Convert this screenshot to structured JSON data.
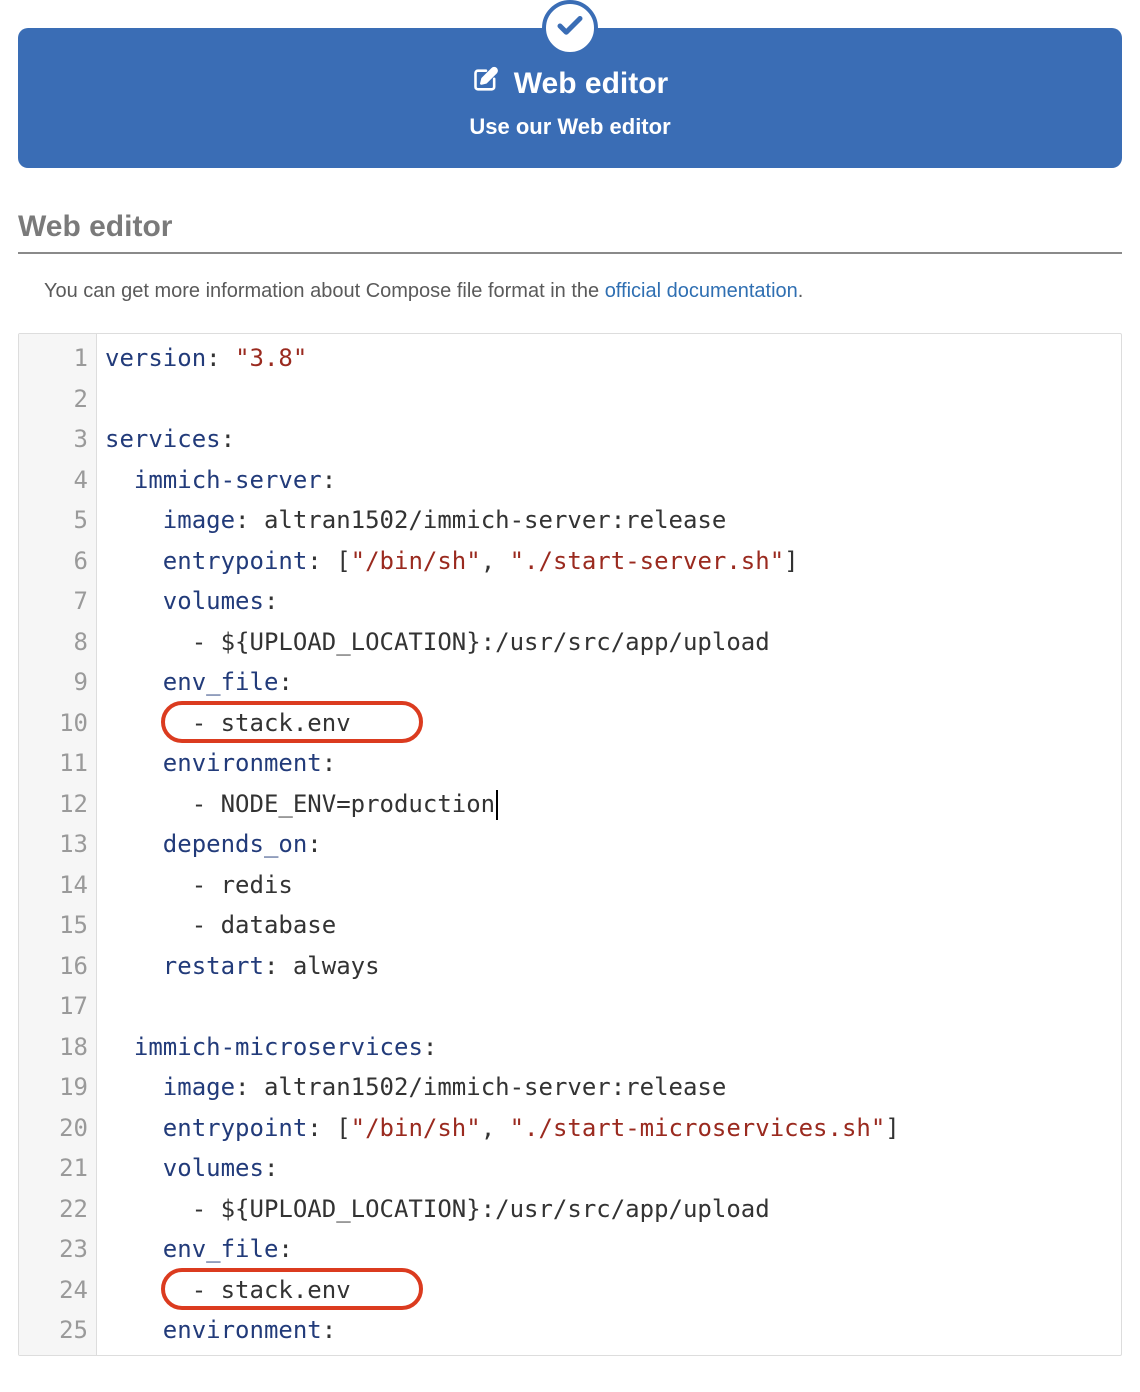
{
  "banner": {
    "title": "Web editor",
    "subtitle": "Use our Web editor"
  },
  "section": {
    "heading": "Web editor",
    "info_prefix": "You can get more information about Compose file format in the ",
    "info_link": "official documentation",
    "info_suffix": "."
  },
  "editor": {
    "lines": [
      {
        "n": 1,
        "tokens": [
          [
            "key",
            "version"
          ],
          [
            "punc",
            ": "
          ],
          [
            "str",
            "\"3.8\""
          ]
        ]
      },
      {
        "n": 2,
        "tokens": []
      },
      {
        "n": 3,
        "tokens": [
          [
            "key",
            "services"
          ],
          [
            "punc",
            ":"
          ]
        ]
      },
      {
        "n": 4,
        "tokens": [
          [
            "plain",
            "  "
          ],
          [
            "key",
            "immich-server"
          ],
          [
            "punc",
            ":"
          ]
        ]
      },
      {
        "n": 5,
        "tokens": [
          [
            "plain",
            "    "
          ],
          [
            "key",
            "image"
          ],
          [
            "punc",
            ": "
          ],
          [
            "plain",
            "altran1502/immich-server:release"
          ]
        ]
      },
      {
        "n": 6,
        "tokens": [
          [
            "plain",
            "    "
          ],
          [
            "key",
            "entrypoint"
          ],
          [
            "punc",
            ": ["
          ],
          [
            "str",
            "\"/bin/sh\""
          ],
          [
            "punc",
            ", "
          ],
          [
            "str",
            "\"./start-server.sh\""
          ],
          [
            "punc",
            "]"
          ]
        ]
      },
      {
        "n": 7,
        "tokens": [
          [
            "plain",
            "    "
          ],
          [
            "key",
            "volumes"
          ],
          [
            "punc",
            ":"
          ]
        ]
      },
      {
        "n": 8,
        "tokens": [
          [
            "plain",
            "      - ${UPLOAD_LOCATION}:/usr/src/app/upload"
          ]
        ]
      },
      {
        "n": 9,
        "tokens": [
          [
            "plain",
            "    "
          ],
          [
            "key",
            "env_file"
          ],
          [
            "punc",
            ":"
          ]
        ]
      },
      {
        "n": 10,
        "tokens": [
          [
            "plain",
            "      - stack.env"
          ]
        ],
        "annot": true
      },
      {
        "n": 11,
        "tokens": [
          [
            "plain",
            "    "
          ],
          [
            "key",
            "environment"
          ],
          [
            "punc",
            ":"
          ]
        ]
      },
      {
        "n": 12,
        "tokens": [
          [
            "plain",
            "      - NODE_ENV=production"
          ]
        ],
        "cursor": true
      },
      {
        "n": 13,
        "tokens": [
          [
            "plain",
            "    "
          ],
          [
            "key",
            "depends_on"
          ],
          [
            "punc",
            ":"
          ]
        ]
      },
      {
        "n": 14,
        "tokens": [
          [
            "plain",
            "      - redis"
          ]
        ]
      },
      {
        "n": 15,
        "tokens": [
          [
            "plain",
            "      - database"
          ]
        ]
      },
      {
        "n": 16,
        "tokens": [
          [
            "plain",
            "    "
          ],
          [
            "key",
            "restart"
          ],
          [
            "punc",
            ": "
          ],
          [
            "plain",
            "always"
          ]
        ]
      },
      {
        "n": 17,
        "tokens": []
      },
      {
        "n": 18,
        "tokens": [
          [
            "plain",
            "  "
          ],
          [
            "key",
            "immich-microservices"
          ],
          [
            "punc",
            ":"
          ]
        ]
      },
      {
        "n": 19,
        "tokens": [
          [
            "plain",
            "    "
          ],
          [
            "key",
            "image"
          ],
          [
            "punc",
            ": "
          ],
          [
            "plain",
            "altran1502/immich-server:release"
          ]
        ]
      },
      {
        "n": 20,
        "tokens": [
          [
            "plain",
            "    "
          ],
          [
            "key",
            "entrypoint"
          ],
          [
            "punc",
            ": ["
          ],
          [
            "str",
            "\"/bin/sh\""
          ],
          [
            "punc",
            ", "
          ],
          [
            "str",
            "\"./start-microservices.sh\""
          ],
          [
            "punc",
            "]"
          ]
        ]
      },
      {
        "n": 21,
        "tokens": [
          [
            "plain",
            "    "
          ],
          [
            "key",
            "volumes"
          ],
          [
            "punc",
            ":"
          ]
        ]
      },
      {
        "n": 22,
        "tokens": [
          [
            "plain",
            "      - ${UPLOAD_LOCATION}:/usr/src/app/upload"
          ]
        ]
      },
      {
        "n": 23,
        "tokens": [
          [
            "plain",
            "    "
          ],
          [
            "key",
            "env_file"
          ],
          [
            "punc",
            ":"
          ]
        ]
      },
      {
        "n": 24,
        "tokens": [
          [
            "plain",
            "      - stack.env"
          ]
        ],
        "annot": true
      },
      {
        "n": 25,
        "tokens": [
          [
            "plain",
            "    "
          ],
          [
            "key",
            "environment"
          ],
          [
            "punc",
            ":"
          ]
        ]
      }
    ]
  }
}
